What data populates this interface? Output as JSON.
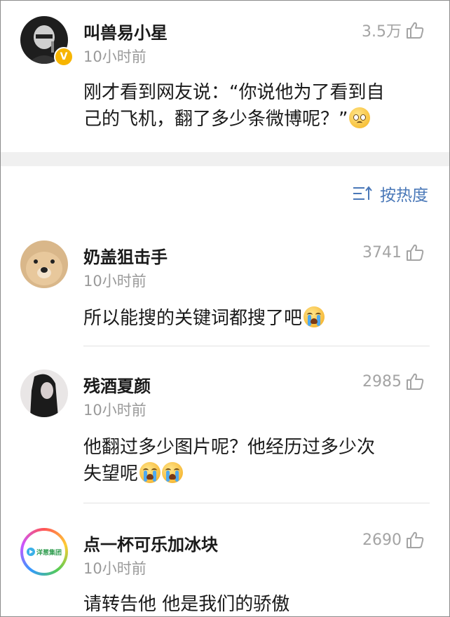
{
  "sort": {
    "label": "按热度",
    "icon": "sort-icon"
  },
  "comments": [
    {
      "name": "叫兽易小星",
      "time": "10小时前",
      "likes": "3.5万",
      "verified": true,
      "text_lines": [
        "刚才看到网友说：“你说他为了看到自",
        "己的飞机，翻了多少条微博呢？”"
      ],
      "emoji": [
        "pout-emoji"
      ]
    },
    {
      "name": "奶盖狙击手",
      "time": "10小时前",
      "likes": "3741",
      "text_lines": [
        "所以能搜的关键词都搜了吧"
      ],
      "emoji": [
        "crying-emoji"
      ]
    },
    {
      "name": "残酒夏颜",
      "time": "10小时前",
      "likes": "2985",
      "text_lines": [
        "他翻过多少图片呢？他经历过多少次",
        "失望呢"
      ],
      "emoji": [
        "crying-emoji",
        "crying-emoji"
      ]
    },
    {
      "name": "点一杯可乐加冰块",
      "time": "10小时前",
      "likes": "2690",
      "avatar_text": "洋葱集团",
      "text_lines": [
        "请转告他 他是我们的骄傲"
      ],
      "emoji": []
    }
  ],
  "colors": {
    "accent": "#4a78b8",
    "muted": "#9a9a9a",
    "separator": "#f0f0f0",
    "verified": "#f7b500"
  }
}
